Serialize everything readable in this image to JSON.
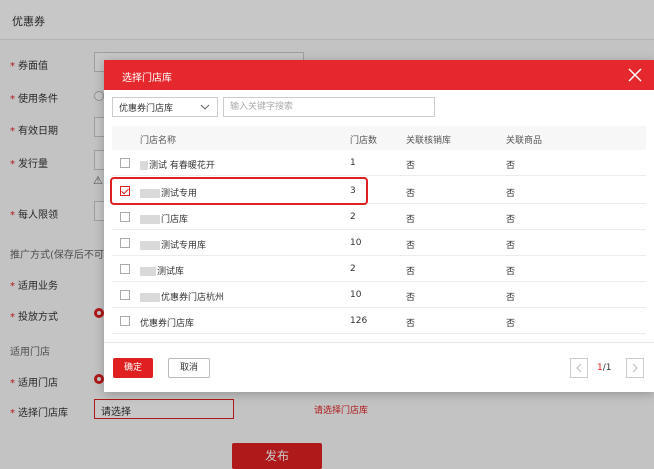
{
  "page": {
    "title": "优惠券",
    "form": {
      "face_value_label": "券面值",
      "condition_label": "使用条件",
      "validity_label": "有效日期",
      "issue_label": "发行量",
      "per_person_label": "每人限领",
      "promo_section": "推广方式(保存后不可修改)",
      "business_label": "适用业务",
      "delivery_label": "投放方式",
      "store_section": "适用门店",
      "store_label": "适用门店",
      "select_store_label": "选择门店库",
      "select_store_value": "请选择",
      "select_store_error": "请选择门店库",
      "publish_label": "发布"
    }
  },
  "modal": {
    "title": "选择门店库",
    "filter": {
      "dropdown_value": "优惠券门店库",
      "search_placeholder": "输入关键字搜索"
    },
    "table": {
      "columns": [
        "门店名称",
        "门店数",
        "关联核销库",
        "关联商品"
      ],
      "rows": [
        {
          "name": "测试 有春暖花开",
          "count": "1",
          "linked_lib": "否",
          "linked_goods": "否",
          "checked": false
        },
        {
          "name": "测试专用",
          "count": "3",
          "linked_lib": "否",
          "linked_goods": "否",
          "checked": true
        },
        {
          "name": "门店库",
          "count": "2",
          "linked_lib": "否",
          "linked_goods": "否",
          "checked": false
        },
        {
          "name": "测试专用库",
          "count": "10",
          "linked_lib": "否",
          "linked_goods": "否",
          "checked": false
        },
        {
          "name": "测试库",
          "count": "2",
          "linked_lib": "否",
          "linked_goods": "否",
          "checked": false
        },
        {
          "name": "优惠券门店杭州",
          "count": "10",
          "linked_lib": "否",
          "linked_goods": "否",
          "checked": false
        },
        {
          "name": "优惠券门店库",
          "count": "126",
          "linked_lib": "否",
          "linked_goods": "否",
          "checked": false
        }
      ]
    },
    "footer": {
      "confirm_label": "确定",
      "cancel_label": "取消",
      "page_current": "1",
      "page_total": "/1"
    }
  },
  "colors": {
    "accent": "#e02020",
    "header": "#e4282d"
  }
}
